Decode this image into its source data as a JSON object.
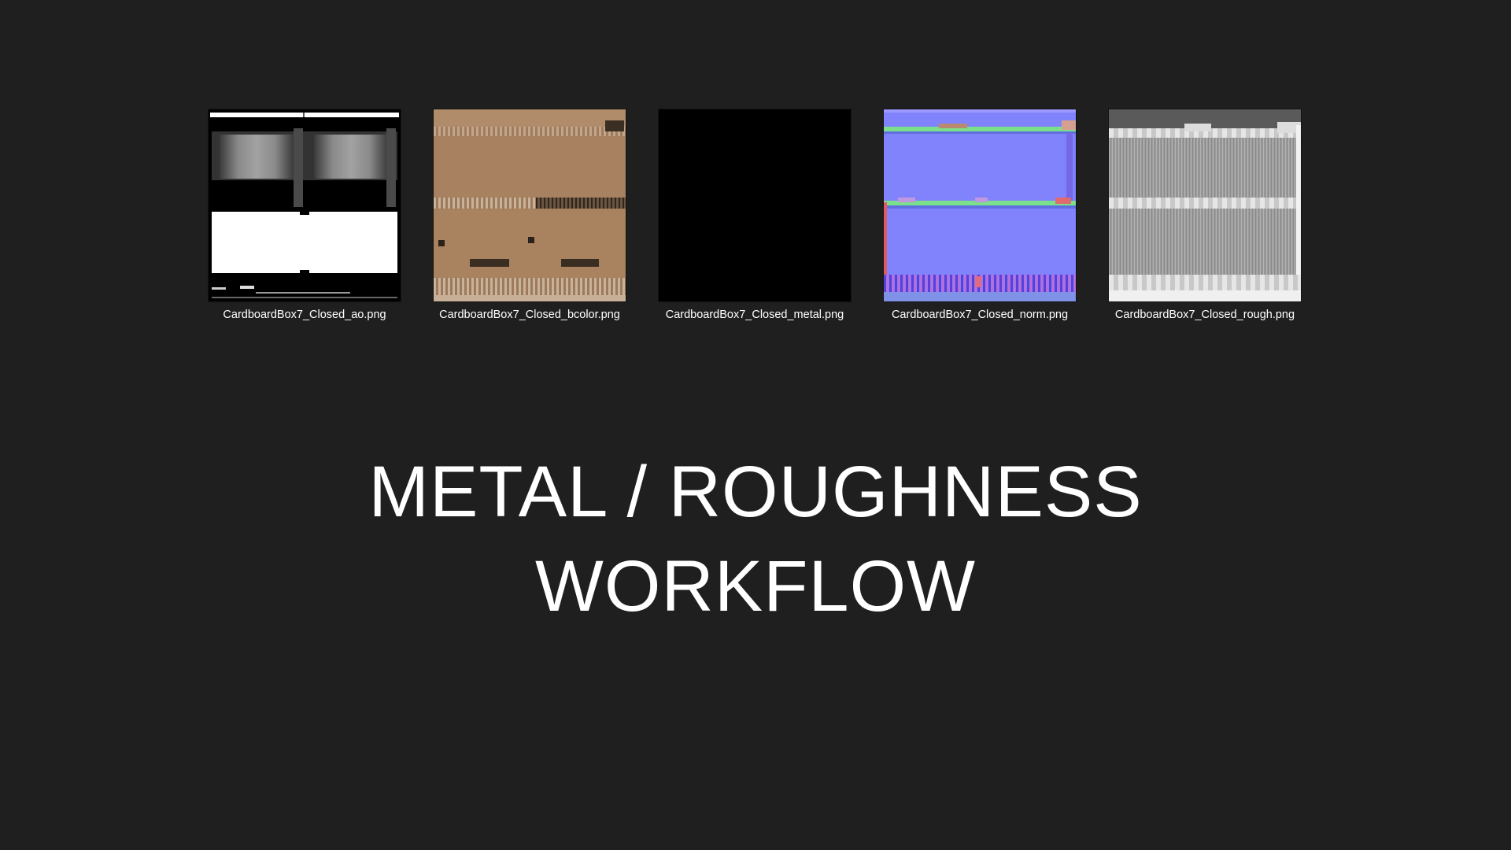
{
  "files": [
    {
      "name": "CardboardBox7_Closed_ao.png",
      "icon": "ambient-occlusion-map-thumbnail"
    },
    {
      "name": "CardboardBox7_Closed_bcolor.png",
      "icon": "base-color-map-thumbnail"
    },
    {
      "name": "CardboardBox7_Closed_metal.png",
      "icon": "metalness-map-thumbnail"
    },
    {
      "name": "CardboardBox7_Closed_norm.png",
      "icon": "normal-map-thumbnail"
    },
    {
      "name": "CardboardBox7_Closed_rough.png",
      "icon": "roughness-map-thumbnail"
    }
  ],
  "headline": {
    "line1": "METAL / ROUGHNESS",
    "line2": "WORKFLOW"
  },
  "colors": {
    "background": "#1f1f1f",
    "text": "#ffffff",
    "cardboard": "#a7805e",
    "normal_blue": "#8080ff"
  }
}
